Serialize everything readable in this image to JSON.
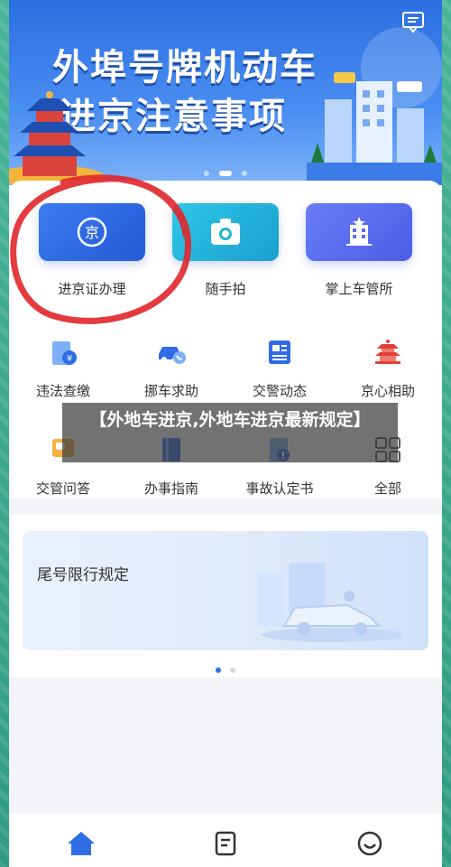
{
  "banner": {
    "title_line1": "外埠号牌机动车",
    "title_line2": "进京注意事项",
    "page_count": 3,
    "active_page": 1
  },
  "features": [
    {
      "label": "进京证办理",
      "icon": "capital-badge-icon",
      "color": "#2f6de6"
    },
    {
      "label": "随手拍",
      "icon": "camera-icon",
      "color": "#1fb3d6"
    },
    {
      "label": "掌上车管所",
      "icon": "office-building-icon",
      "color": "#5a6ef0"
    }
  ],
  "services": [
    {
      "label": "违法查缴",
      "icon": "violation-payment-icon"
    },
    {
      "label": "挪车求助",
      "icon": "move-car-call-icon"
    },
    {
      "label": "交警动态",
      "icon": "news-icon"
    },
    {
      "label": "京心相助",
      "icon": "temple-icon"
    },
    {
      "label": "交管问答",
      "icon": "qa-icon"
    },
    {
      "label": "办事指南",
      "icon": "guide-book-icon"
    },
    {
      "label": "事故认定书",
      "icon": "accident-document-icon"
    },
    {
      "label": "全部",
      "icon": "grid-all-icon"
    }
  ],
  "rule_card": {
    "title": "尾号限行规定",
    "page_count": 2,
    "active_page": 0
  },
  "caption": {
    "text": "【外地车进京,外地车进京最新规定】"
  },
  "bottom_nav": [
    {
      "icon": "home-icon",
      "active": true
    },
    {
      "icon": "document-icon",
      "active": false
    },
    {
      "icon": "smile-icon",
      "active": false
    }
  ],
  "colors": {
    "primary": "#2f6de6",
    "annotation_red": "#e0262b",
    "frame_green": "#3aa88a"
  }
}
